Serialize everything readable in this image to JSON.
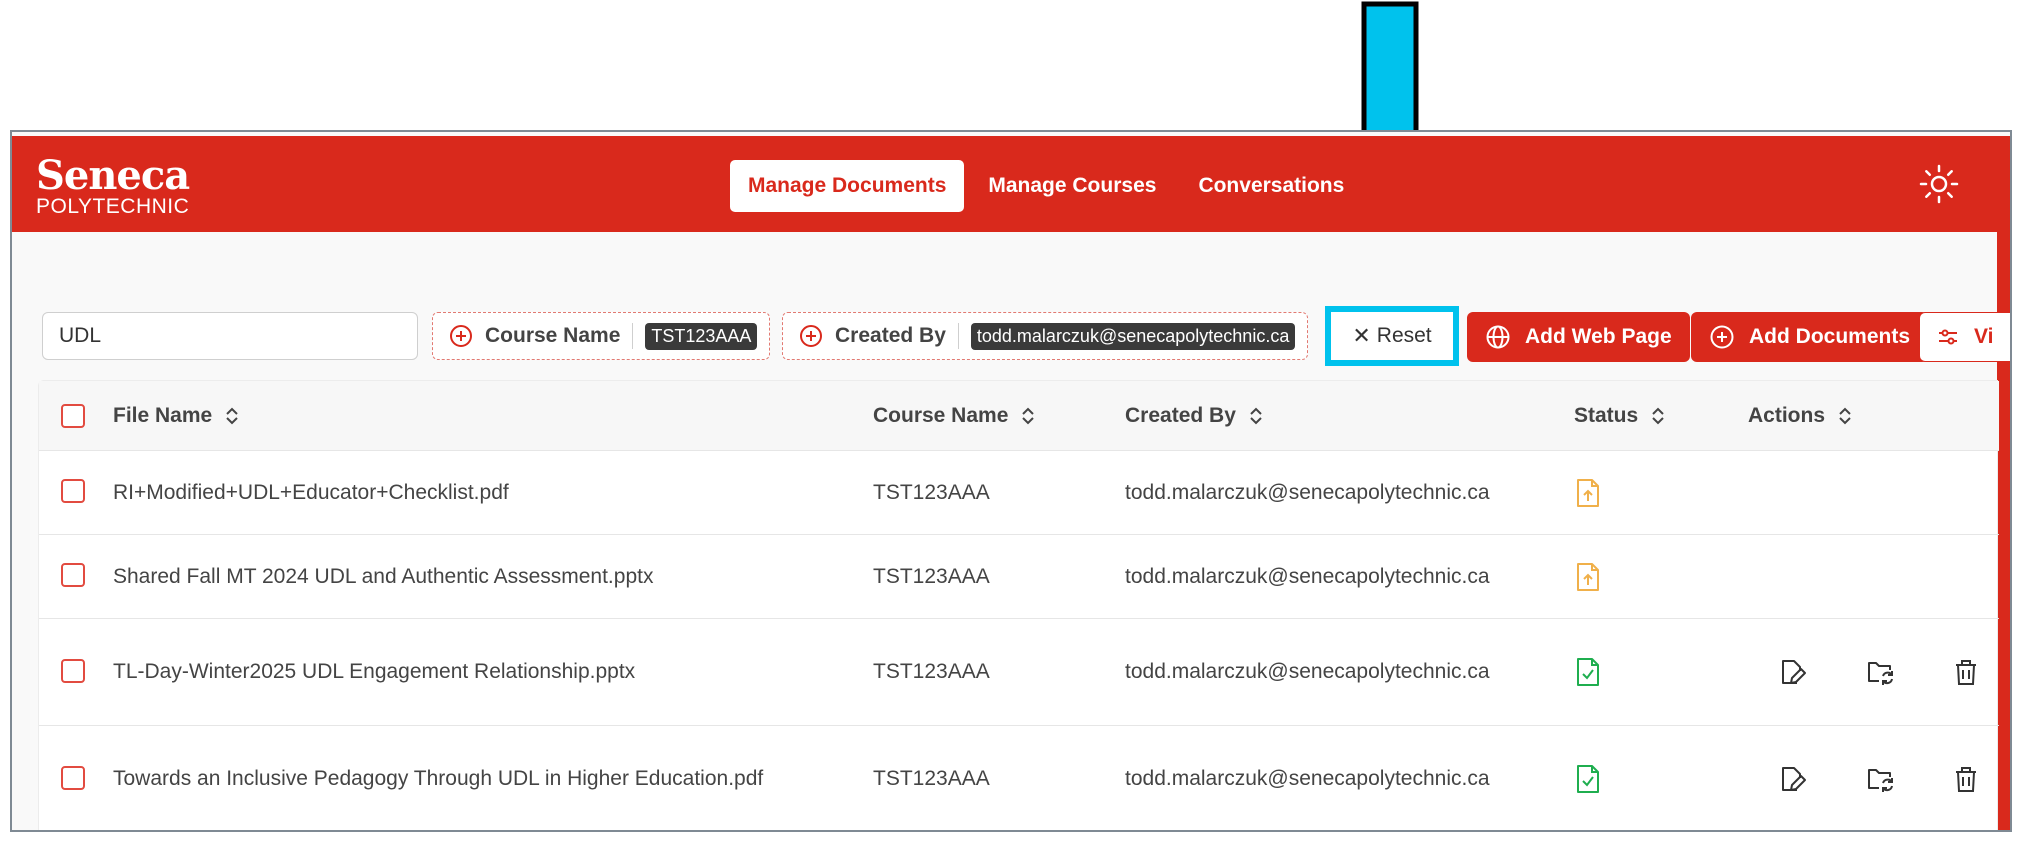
{
  "header": {
    "logo_main": "Seneca",
    "logo_sub": "POLYTECHNIC",
    "nav": [
      {
        "label": "Manage Documents",
        "active": true
      },
      {
        "label": "Manage Courses",
        "active": false
      },
      {
        "label": "Conversations",
        "active": false
      }
    ],
    "theme_icon": "sun-icon"
  },
  "toolbar": {
    "search_value": "UDL",
    "filters": [
      {
        "label": "Course Name",
        "value": "TST123AAA"
      },
      {
        "label": "Created By",
        "value": "todd.malarczuk@senecapolytechnic.ca"
      }
    ],
    "reset_label": "Reset",
    "add_web_page_label": "Add Web Page",
    "add_documents_label": "Add Documents",
    "view_label": "Vi"
  },
  "table": {
    "columns": [
      "File Name",
      "Course Name",
      "Created By",
      "Status",
      "Actions"
    ],
    "rows": [
      {
        "file_name": "RI+Modified+UDL+Educator+Checklist.pdf",
        "course": "TST123AAA",
        "created_by": "todd.malarczuk@senecapolytechnic.ca",
        "status": "uploading",
        "has_actions": false
      },
      {
        "file_name": "Shared Fall MT 2024 UDL and Authentic Assessment.pptx",
        "course": "TST123AAA",
        "created_by": "todd.malarczuk@senecapolytechnic.ca",
        "status": "uploading",
        "has_actions": false
      },
      {
        "file_name": "TL-Day-Winter2025 UDL Engagement Relationship.pptx",
        "course": "TST123AAA",
        "created_by": "todd.malarczuk@senecapolytechnic.ca",
        "status": "processed",
        "has_actions": true
      },
      {
        "file_name": "Towards an Inclusive Pedagogy Through UDL in Higher Education.pdf",
        "course": "TST123AAA",
        "created_by": "todd.malarczuk@senecapolytechnic.ca",
        "status": "processed",
        "has_actions": true
      }
    ]
  },
  "colors": {
    "brand_red": "#d9291c",
    "highlight_cyan": "#00c2ed",
    "status_uploading": "#f0b04a",
    "status_processed": "#1fae4f"
  }
}
